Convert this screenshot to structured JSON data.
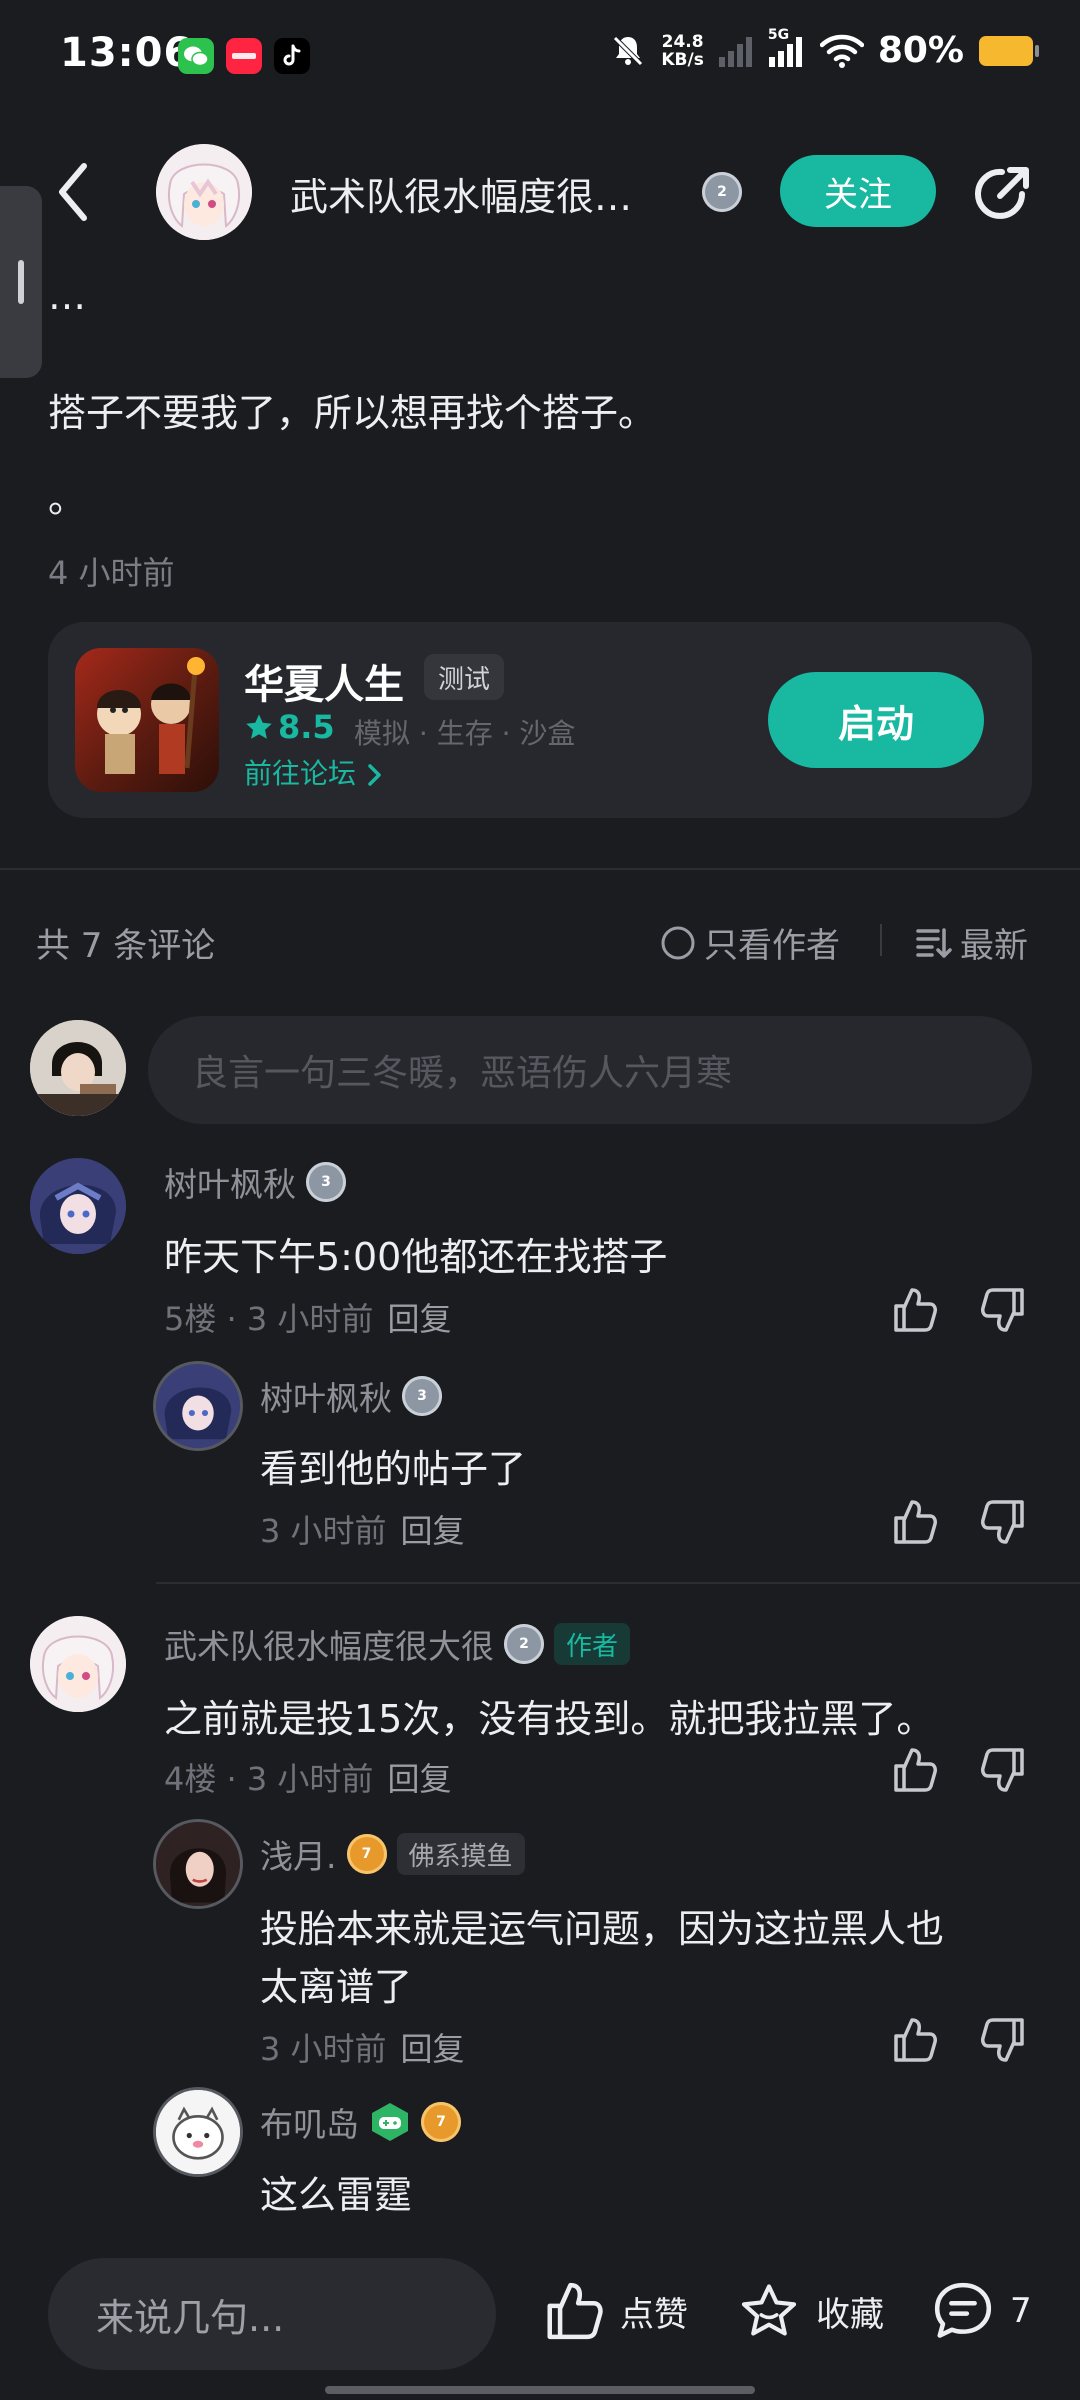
{
  "status_bar": {
    "time": "13:06",
    "apps": [
      "wechat-icon",
      "xiaohongshu-icon",
      "tiktok-icon"
    ],
    "net_speed_value": "24.8",
    "net_speed_unit": "KB/s",
    "network": "5G",
    "battery": "80%"
  },
  "header": {
    "title": "武术队很水幅度很…",
    "level": "2",
    "follow_label": "关注"
  },
  "post": {
    "ellipsis": "…",
    "body": "搭子不要我了，所以想再找个搭子。",
    "dot": "。",
    "time": "4 小时前"
  },
  "game": {
    "name": "华夏人生",
    "tag": "测试",
    "score": "8.5",
    "genres": "模拟 · 生存 · 沙盒",
    "forum_link": "前往论坛",
    "launch_label": "启动"
  },
  "comments_header": {
    "count": "共 7 条评论",
    "author_only": "只看作者",
    "sort": "最新"
  },
  "comment_input_placeholder": "良言一句三冬暖，恶语伤人六月寒",
  "comments": [
    {
      "user": "树叶枫秋",
      "level": "3",
      "text": "昨天下午5:00他都还在找搭子",
      "floor": "5楼",
      "time": "3 小时前",
      "reply": "回复",
      "replies": [
        {
          "user": "树叶枫秋",
          "level": "3",
          "text": "看到他的帖子了",
          "time": "3 小时前",
          "reply": "回复"
        }
      ]
    },
    {
      "user": "武术队很水幅度很大很",
      "level": "2",
      "tag": "作者",
      "text": "之前就是投15次，没有投到。就把我拉黑了。",
      "floor": "4楼",
      "time": "3 小时前",
      "reply": "回复",
      "replies": [
        {
          "user": "浅月.",
          "level": "7",
          "tag": "佛系摸鱼",
          "text_line1": "投胎本来就是运气问题，因为这拉黑人也",
          "text_line2": "太离谱了",
          "time": "3 小时前",
          "reply": "回复"
        },
        {
          "user": "布叽岛",
          "level": "7",
          "text": "这么雷霆"
        }
      ]
    }
  ],
  "bottom_bar": {
    "input_placeholder": "来说几句...",
    "like_label": "点赞",
    "favorite_label": "收藏",
    "comment_count": "7"
  },
  "colors": {
    "background": "#1b1c20",
    "accent": "#18b8a1",
    "card": "#27282d",
    "text": "#eceef1",
    "muted": "#7a7d84",
    "battery": "#f5b82e"
  }
}
